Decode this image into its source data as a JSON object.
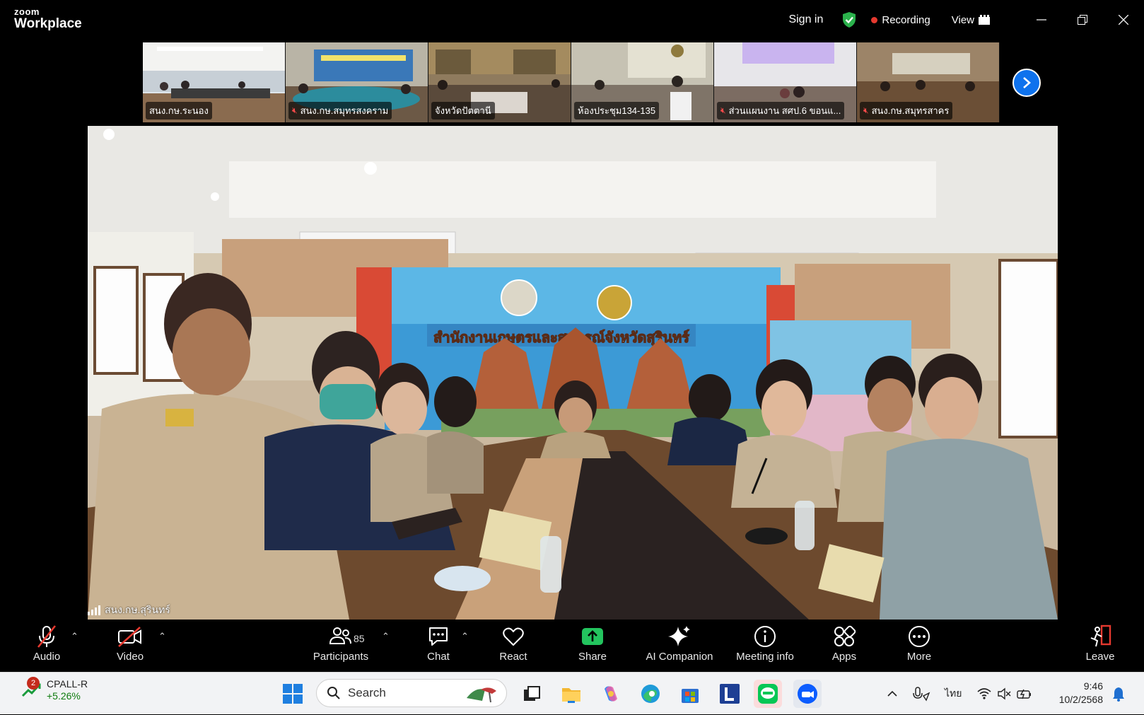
{
  "app": {
    "logo_line1": "zoom",
    "logo_line2": "Workplace",
    "sign_in": "Sign in",
    "recording": "Recording",
    "view": "View"
  },
  "thumbnails": [
    {
      "label": "สนง.กษ.ระนอง",
      "muted": false
    },
    {
      "label": "สนง.กษ.สมุทรสงคราม",
      "muted": true
    },
    {
      "label": "จังหวัดปัตตานี",
      "muted": false
    },
    {
      "label": "ห้องประชุม134-135",
      "muted": false
    },
    {
      "label": "ส่วนแผนงาน สศป.6 ขอนแ...",
      "muted": true
    },
    {
      "label": "สนง.กษ.สมุทรสาคร",
      "muted": true
    }
  ],
  "main_video": {
    "speaker_name": "สนง.กษ.สุรินทร์",
    "banner_text": "สำนักงานเกษตรและสหกรณ์จังหวัดสุรินทร์"
  },
  "toolbar": {
    "audio": "Audio",
    "video": "Video",
    "participants": "Participants",
    "participants_count": "85",
    "chat": "Chat",
    "react": "React",
    "share": "Share",
    "ai_companion": "AI Companion",
    "meeting_info": "Meeting info",
    "apps": "Apps",
    "more": "More",
    "leave": "Leave"
  },
  "taskbar": {
    "stock_ticker": "CPALL-R",
    "stock_change": "+5.26%",
    "widget_badge": "2",
    "search_placeholder": "Search",
    "language": "ไทย",
    "time": "9:46",
    "date": "10/2/2568"
  },
  "colors": {
    "accent_blue": "#0e72ed",
    "share_green": "#23c45e",
    "record_red": "#e5392f",
    "shield_green": "#2bb24c"
  }
}
